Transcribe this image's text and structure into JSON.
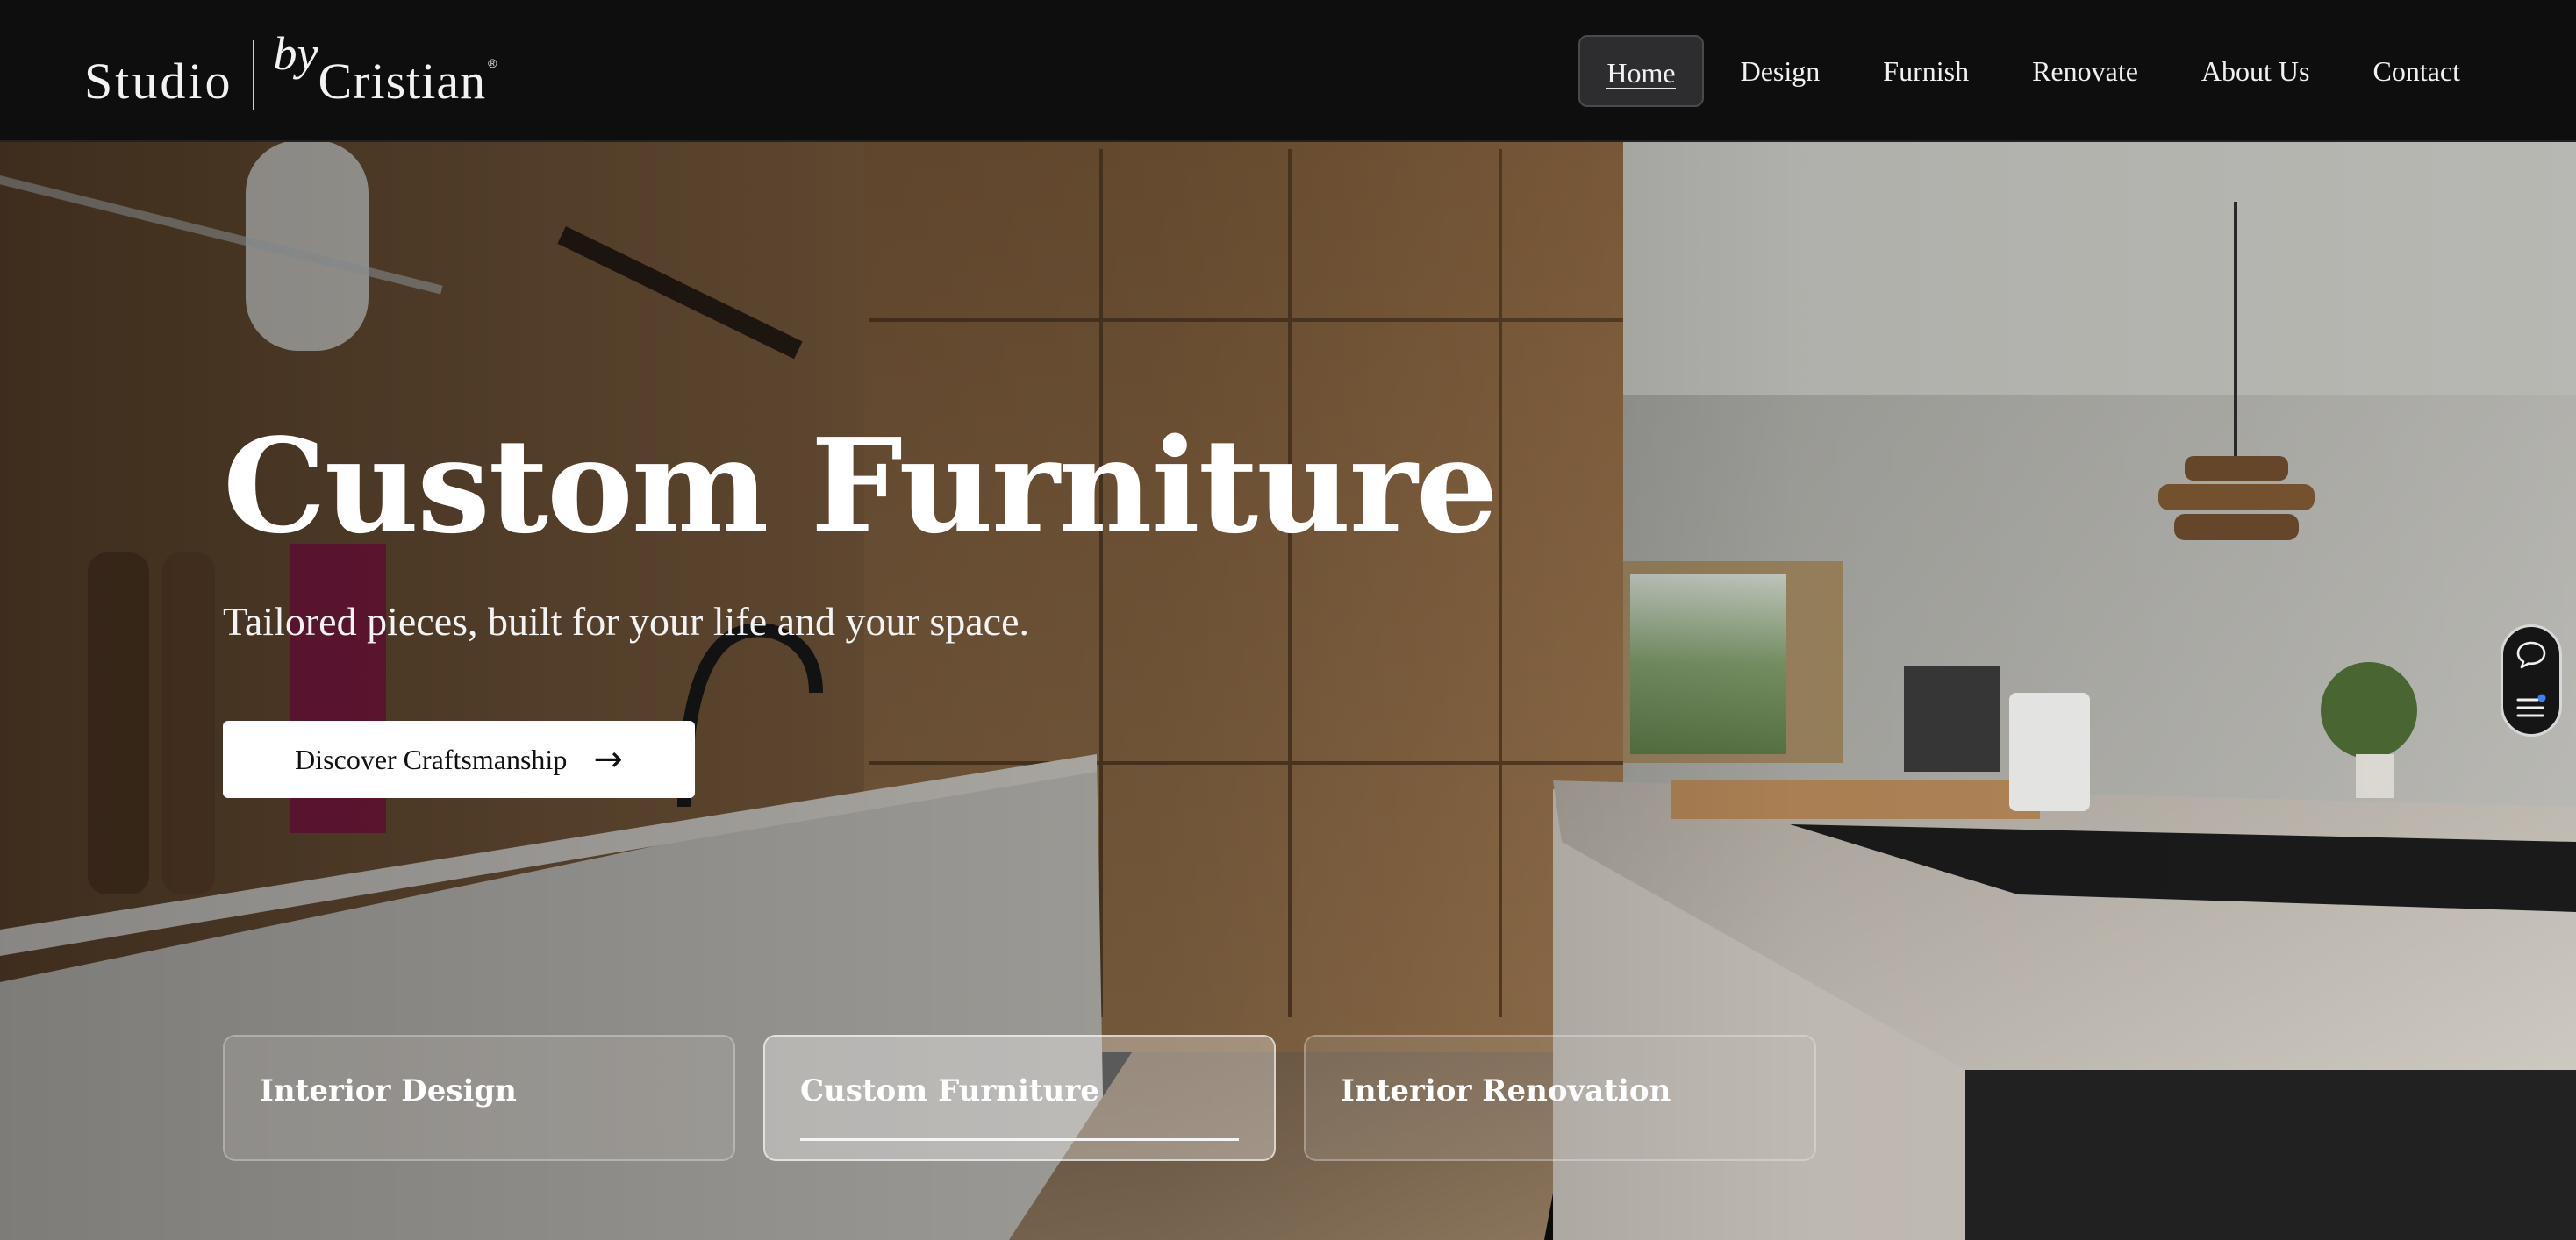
{
  "header": {
    "logo": {
      "studio": "Studio",
      "by": "by",
      "name": "Cristian",
      "reg": "®"
    },
    "nav": [
      {
        "label": "Home",
        "active": true
      },
      {
        "label": "Design"
      },
      {
        "label": "Furnish"
      },
      {
        "label": "Renovate"
      },
      {
        "label": "About Us"
      },
      {
        "label": "Contact"
      }
    ]
  },
  "hero": {
    "title": "Custom Furniture",
    "subtitle": "Tailored pieces, built for your life and your space.",
    "cta": {
      "label": "Discover Craftsmanship",
      "icon": "arrow-right-icon",
      "arrow": "→"
    },
    "cards": [
      {
        "label": "Interior Design"
      },
      {
        "label": "Custom Furniture",
        "active": true
      },
      {
        "label": "Interior Renovation"
      }
    ]
  },
  "widget": {
    "icons": [
      "chat-icon",
      "menu-icon"
    ],
    "indicator_color": "#3b82f6"
  },
  "colors": {
    "header_bg": "#0e0e0e",
    "cta_bg": "#ffffff",
    "text": "#ffffff"
  }
}
